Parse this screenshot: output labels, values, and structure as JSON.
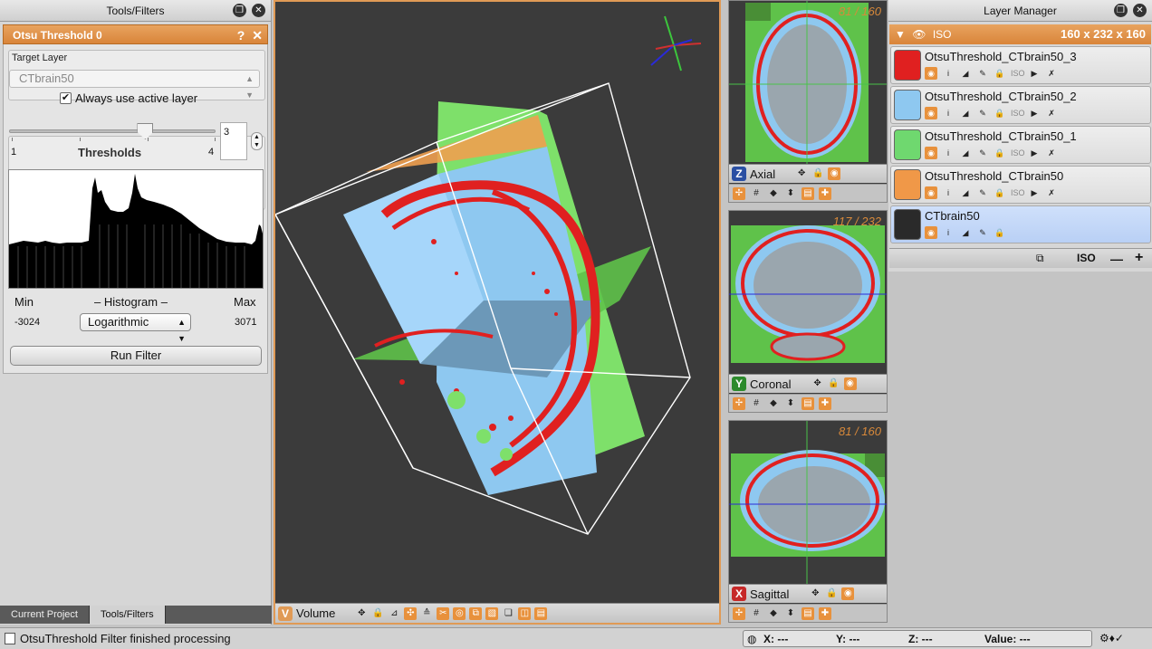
{
  "tools_panel": {
    "title": "Tools/Filters",
    "tool_title": "Otsu Threshold 0",
    "help_label": "?",
    "target_layer_label": "Target Layer",
    "target_layer_value": "CTbrain50",
    "always_active_label": "Always use active layer",
    "always_active_checked": true,
    "thresholds": {
      "label": "Thresholds",
      "min": "1",
      "max": "4",
      "value": "3",
      "slider_fraction": 0.66
    },
    "histogram": {
      "title": "– Histogram –",
      "min_label": "Min",
      "max_label": "Max",
      "min_value": "-3024",
      "max_value": "3071",
      "scale": "Logarithmic"
    },
    "run_button": "Run Filter"
  },
  "bottom_tabs": [
    {
      "label": "Current Project",
      "active": false
    },
    {
      "label": "Tools/Filters",
      "active": true
    }
  ],
  "viewer": {
    "name": "Volume",
    "axis_badge": "V"
  },
  "slices": [
    {
      "name": "Axial",
      "badge": "Z",
      "badge_color": "#2a4fa3",
      "count": "81 / 160"
    },
    {
      "name": "Coronal",
      "badge": "Y",
      "badge_color": "#2c8a2c",
      "count": "117 / 232"
    },
    {
      "name": "Sagittal",
      "badge": "X",
      "badge_color": "#c62828",
      "count": "81 / 160"
    }
  ],
  "layer_manager": {
    "title": "Layer Manager",
    "group_label": "ISO",
    "group_dims": "160 x 232 x 160",
    "layers": [
      {
        "name": "OtsuThreshold_CTbrain50_3",
        "color": "#e02020",
        "selected": false,
        "iso": "ISO"
      },
      {
        "name": "OtsuThreshold_CTbrain50_2",
        "color": "#8ec8f0",
        "selected": false,
        "iso": "ISO"
      },
      {
        "name": "OtsuThreshold_CTbrain50_1",
        "color": "#6fd86f",
        "selected": false,
        "iso": "ISO"
      },
      {
        "name": "OtsuThreshold_CTbrain50",
        "color": "#f09848",
        "selected": false,
        "iso": "ISO"
      },
      {
        "name": "CTbrain50",
        "color": "#2a2a2a",
        "selected": true,
        "iso": ""
      }
    ],
    "footer_iso": "ISO",
    "minus": "—",
    "plus": "+"
  },
  "status": {
    "message": "OtsuThreshold Filter finished processing",
    "x_label": "X: ---",
    "y_label": "Y: ---",
    "z_label": "Z: ---",
    "value_label": "Value: ---"
  },
  "colors": {
    "accent": "#e09a55",
    "red": "#e02020",
    "blue": "#8ec8f0",
    "green": "#6fd86f",
    "orange": "#f09848"
  }
}
